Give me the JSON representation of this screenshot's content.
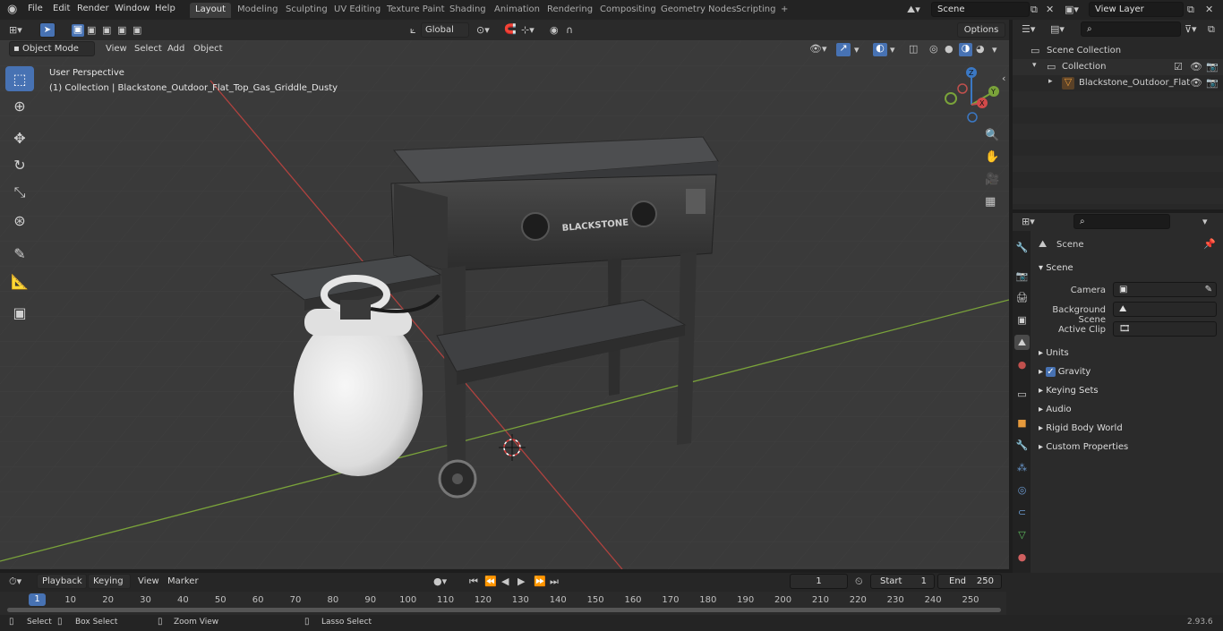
{
  "topbar": {
    "menus": [
      "File",
      "Edit",
      "Render",
      "Window",
      "Help"
    ],
    "workspaces": [
      "Layout",
      "Modeling",
      "Sculpting",
      "UV Editing",
      "Texture Paint",
      "Shading",
      "Animation",
      "Rendering",
      "Compositing",
      "Geometry Nodes",
      "Scripting"
    ],
    "active_workspace": "Layout",
    "add_tab": "+",
    "scene_name": "Scene",
    "view_layer": "View Layer"
  },
  "viewport_header": {
    "mode": "Object Mode",
    "menus": [
      "View",
      "Select",
      "Add",
      "Object"
    ],
    "orientation": "Global",
    "options": "Options"
  },
  "viewport": {
    "perspective_label": "User Perspective",
    "collection_label": "(1) Collection | Blackstone_Outdoor_Flat_Top_Gas_Griddle_Dusty",
    "griddle_brand": "BLACKSTONE",
    "gizmo_labels": {
      "x": "X",
      "y": "Y",
      "z": "Z"
    }
  },
  "outliner": {
    "root": "Scene Collection",
    "collection": "Collection",
    "object": "Blackstone_Outdoor_Flat"
  },
  "properties": {
    "breadcrumb": "Scene",
    "panel_title": "Scene",
    "camera_label": "Camera",
    "background_scene_label": "Background Scene",
    "active_clip_label": "Active Clip",
    "sections": [
      "Units",
      "Gravity",
      "Keying Sets",
      "Audio",
      "Rigid Body World",
      "Custom Properties"
    ],
    "gravity_checked": true
  },
  "timeline": {
    "menus": [
      "Playback",
      "Keying",
      "View",
      "Marker"
    ],
    "current_frame": "1",
    "start_label": "Start",
    "start_value": "1",
    "end_label": "End",
    "end_value": "250",
    "frame_ticks": [
      "1",
      "10",
      "20",
      "30",
      "40",
      "50",
      "60",
      "70",
      "80",
      "90",
      "100",
      "110",
      "120",
      "130",
      "140",
      "150",
      "160",
      "170",
      "180",
      "190",
      "200",
      "210",
      "220",
      "230",
      "240",
      "250"
    ]
  },
  "statusbar": {
    "select": "Select",
    "box_select": "Box Select",
    "zoom_view": "Zoom View",
    "lasso_select": "Lasso Select",
    "version": "2.93.6"
  },
  "colors": {
    "accent": "#4772b3",
    "x_axis": "#c0504d",
    "y_axis": "#8dc63f",
    "viewport_bg": "#3a3a3a"
  }
}
